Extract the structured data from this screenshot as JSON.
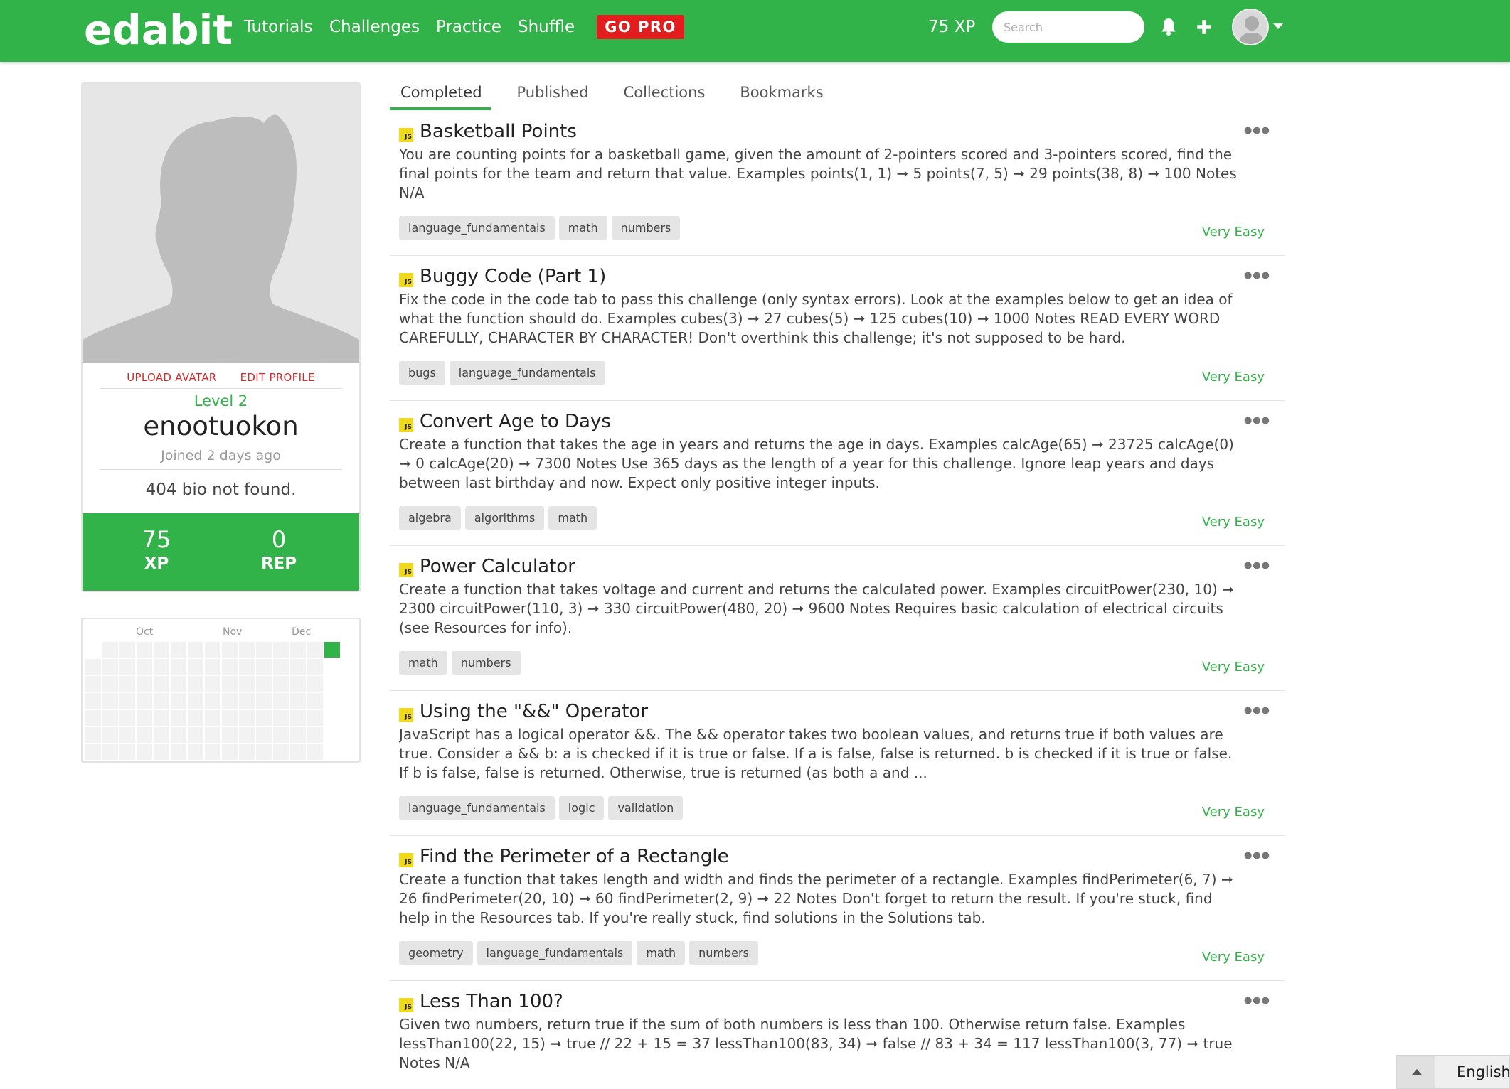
{
  "navbar": {
    "logo": "edabit",
    "links": [
      "Tutorials",
      "Challenges",
      "Practice",
      "Shuffle"
    ],
    "go_pro": "GO PRO",
    "xp": "75 XP",
    "search_placeholder": "Search",
    "brand_color": "#32b34a",
    "go_pro_color": "#e31d1d"
  },
  "profile": {
    "upload_avatar": "UPLOAD AVATAR",
    "edit_profile": "EDIT PROFILE",
    "level": "Level 2",
    "username": "enootuokon",
    "joined": "Joined 2 days ago",
    "bio": "404 bio not found.",
    "xp_value": "75",
    "xp_label": "XP",
    "rep_value": "0",
    "rep_label": "REP"
  },
  "calendar": {
    "months": [
      "Oct",
      "Nov",
      "Dec"
    ]
  },
  "tabs": [
    "Completed",
    "Published",
    "Collections",
    "Bookmarks"
  ],
  "active_tab": "Completed",
  "challenges": [
    {
      "lang": "JS",
      "title": "Basketball Points",
      "desc": "You are counting points for a basketball game, given the amount of 2-pointers scored and 3-pointers scored, find the final points for the team and return that value. Examples points(1, 1) ➞ 5 points(7, 5) ➞ 29 points(38, 8) ➞ 100 Notes N/A",
      "tags": [
        "language_fundamentals",
        "math",
        "numbers"
      ],
      "difficulty": "Very Easy"
    },
    {
      "lang": "JS",
      "title": "Buggy Code (Part 1)",
      "desc": "Fix the code in the code tab to pass this challenge (only syntax errors). Look at the examples below to get an idea of what the function should do. Examples cubes(3) ➞ 27 cubes(5) ➞ 125 cubes(10) ➞ 1000 Notes READ EVERY WORD CAREFULLY, CHARACTER BY CHARACTER! Don't overthink this challenge; it's not supposed to be hard.",
      "tags": [
        "bugs",
        "language_fundamentals"
      ],
      "difficulty": "Very Easy"
    },
    {
      "lang": "JS",
      "title": "Convert Age to Days",
      "desc": "Create a function that takes the age in years and returns the age in days. Examples calcAge(65) ➞ 23725 calcAge(0) ➞ 0 calcAge(20) ➞ 7300 Notes Use 365 days as the length of a year for this challenge. Ignore leap years and days between last birthday and now. Expect only positive integer inputs.",
      "tags": [
        "algebra",
        "algorithms",
        "math"
      ],
      "difficulty": "Very Easy"
    },
    {
      "lang": "JS",
      "title": "Power Calculator",
      "desc": "Create a function that takes voltage and current and returns the calculated power. Examples circuitPower(230, 10) ➞ 2300 circuitPower(110, 3) ➞ 330 circuitPower(480, 20) ➞ 9600 Notes Requires basic calculation of electrical circuits (see Resources for info).",
      "tags": [
        "math",
        "numbers"
      ],
      "difficulty": "Very Easy"
    },
    {
      "lang": "JS",
      "title": "Using the \"&&\" Operator",
      "desc": "JavaScript has a logical operator &&. The && operator takes two boolean values, and returns true if both values are true. Consider a && b: a is checked if it is true or false. If a is false, false is returned. b is checked if it is true or false. If b is false, false is returned. Otherwise, true is returned (as both a and ...",
      "tags": [
        "language_fundamentals",
        "logic",
        "validation"
      ],
      "difficulty": "Very Easy"
    },
    {
      "lang": "JS",
      "title": "Find the Perimeter of a Rectangle",
      "desc": "Create a function that takes length and width and finds the perimeter of a rectangle. Examples findPerimeter(6, 7) ➞ 26 findPerimeter(20, 10) ➞ 60 findPerimeter(2, 9) ➞ 22 Notes Don't forget to return the result. If you're stuck, find help in the Resources tab. If you're really stuck, find solutions in the Solutions tab.",
      "tags": [
        "geometry",
        "language_fundamentals",
        "math",
        "numbers"
      ],
      "difficulty": "Very Easy"
    },
    {
      "lang": "JS",
      "title": "Less Than 100?",
      "desc": "Given two numbers, return true if the sum of both numbers is less than 100. Otherwise return false. Examples lessThan100(22, 15) ➞ true // 22 + 15 = 37 lessThan100(83, 34) ➞ false // 83 + 34 = 117 lessThan100(3, 77) ➞ true Notes N/A",
      "tags": [],
      "difficulty": ""
    }
  ],
  "language_widget": {
    "label": "English"
  }
}
